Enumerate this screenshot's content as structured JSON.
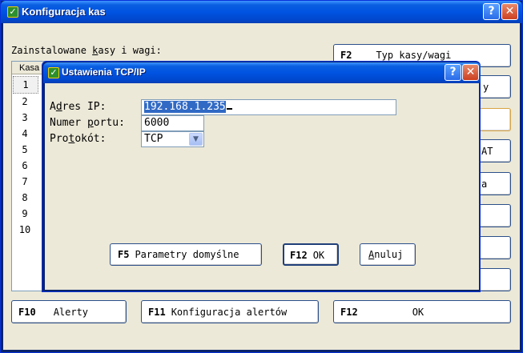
{
  "window": {
    "title": "Konfiguracja kas"
  },
  "main": {
    "installed_label_pre": "Zainstalowane ",
    "installed_label_k": "k",
    "installed_label_post": "asy i wagi:",
    "list": {
      "header": "Kasa",
      "rows": [
        "1",
        "2",
        "3",
        "4",
        "5",
        "6",
        "7",
        "8",
        "9",
        "10"
      ]
    },
    "right_buttons": {
      "type_key": "F2",
      "type_label": "Typ kasy/wagi",
      "partial_1": "y",
      "partial_2": "AT",
      "partial_3": "a"
    },
    "bottom_buttons": [
      {
        "key": "F10",
        "label": "Alerty"
      },
      {
        "key": "F11",
        "label": "Konfiguracja alertów"
      },
      {
        "key": "F12",
        "label": "OK"
      }
    ]
  },
  "dialog": {
    "title": "Ustawienia TCP/IP",
    "ip_label_pre": "A",
    "ip_label_u": "d",
    "ip_label_post": "res IP:",
    "ip_value": "192.168.1.235",
    "port_label_pre": "Numer ",
    "port_label_u": "p",
    "port_label_post": "ortu:",
    "port_value": "6000",
    "proto_label_pre": "Pro",
    "proto_label_u": "t",
    "proto_label_post": "okót:",
    "proto_value": "TCP",
    "defaults_key": "F5",
    "defaults_label": "Parametry domyślne",
    "ok_key": "F12",
    "ok_label": "OK",
    "cancel_u": "A",
    "cancel_rest": "nuluj"
  },
  "colors": {
    "title_blue": "#0053e1",
    "face": "#ece9d8",
    "selection": "#316ac5"
  },
  "icons": {
    "app": "app-icon",
    "help": "help-icon",
    "close": "close-icon",
    "dropdown": "chevron-down-icon"
  }
}
